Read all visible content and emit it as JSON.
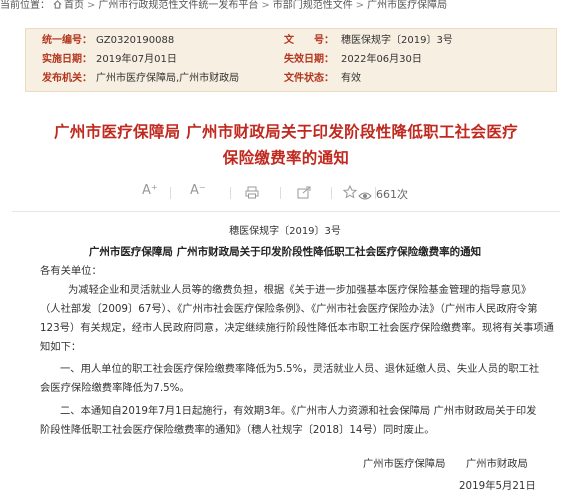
{
  "breadcrumb": {
    "lead": "当前位置：",
    "items": [
      "首页",
      "广州市行政规范性文件统一发布平台",
      "市部门规范性文件",
      "广州市医疗保障局"
    ]
  },
  "meta": {
    "unified_no_label": "统一编号：",
    "unified_no": "GZ0320190088",
    "doc_no_label": "文　　号：",
    "doc_no": "穗医保规字〔2019〕3号",
    "effective_label": "实施日期：",
    "effective": "2019年07月01日",
    "expire_label": "失效日期：",
    "expire": "2022年06月30日",
    "issuer_label": "发布机关：",
    "issuer": "广州市医疗保障局,广州市财政局",
    "status_label": "文件状态：",
    "status": "有效"
  },
  "title_line1": "广州市医疗保障局 广州市财政局关于印发阶段性降低职工社会医疗",
  "title_line2": "保险缴费率的通知",
  "toolbar": {
    "font_up": "A⁺",
    "font_down": "A⁻",
    "print_icon": "print-icon",
    "share_icon": "share-icon",
    "star_icon": "star-icon",
    "views": "661次"
  },
  "doc_number": "穗医保规字〔2019〕3号",
  "subtitle": "广州市医疗保障局 广州市财政局关于印发阶段性降低职工社会医疗保险缴费率的通知",
  "body": {
    "salutation": "各有关单位：",
    "p1_l1": "为减轻企业和灵活就业人员等的缴费负担，根据《关于进一步加强基本医疗保险基金管理的指导意见》",
    "p1_l2": "（人社部发〔2009〕67号）、《广州市社会医疗保险条例》、《广州市社会医疗保险办法》（广州市人民政府令第",
    "p1_l3": "123号）有关规定，经市人民政府同意，决定继续施行阶段性降低本市职工社会医疗保险缴费率。现将有关事项通",
    "p1_l4": "知如下：",
    "p2_l1": "一、用人单位的职工社会医疗保险缴费率降低为5.5%，灵活就业人员、退休延缴人员、失业人员的职工社",
    "p2_l2": "会医疗保险缴费率降低为7.5%。",
    "p3_l1": "二、本通知自2019年7月1日起施行，有效期3年。《广州市人力资源和社会保障局 广州市财政局关于印发",
    "p3_l2": "阶段性降低职工社会医疗保险缴费率的通知》（穗人社规字〔2018〕14号）同时废止。",
    "sign1": "广州市医疗保障局",
    "sign2": "广州市财政局",
    "date": "2019年5月21日"
  }
}
